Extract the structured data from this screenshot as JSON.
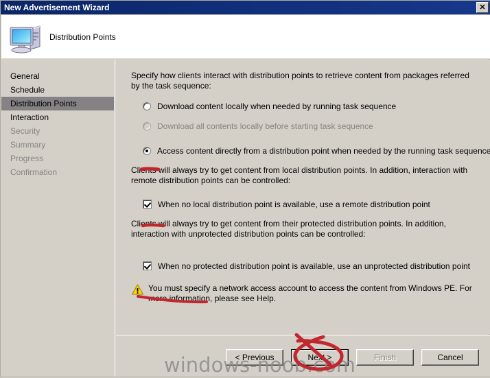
{
  "window": {
    "title": "New Advertisement Wizard",
    "close_label": "✕"
  },
  "header": {
    "title": "Distribution Points",
    "icon": "computer-icon"
  },
  "sidebar": {
    "items": [
      {
        "label": "General",
        "state": "normal"
      },
      {
        "label": "Schedule",
        "state": "normal"
      },
      {
        "label": "Distribution Points",
        "state": "selected"
      },
      {
        "label": "Interaction",
        "state": "normal"
      },
      {
        "label": "Security",
        "state": "disabled"
      },
      {
        "label": "Summary",
        "state": "disabled"
      },
      {
        "label": "Progress",
        "state": "disabled"
      },
      {
        "label": "Confirmation",
        "state": "disabled"
      }
    ]
  },
  "content": {
    "intro": "Specify how clients interact with distribution points to retrieve content from packages referred by the task sequence:",
    "radio_options": [
      {
        "label": "Download content locally when needed by running task sequence",
        "accel": "D",
        "checked": false,
        "disabled": false
      },
      {
        "label": "Download all contents locally before starting task sequence",
        "accel": "o",
        "checked": false,
        "disabled": true
      },
      {
        "label": "Access content directly from a distribution point when needed by the running task sequence",
        "accel": "c",
        "checked": true,
        "disabled": false
      }
    ],
    "local_note": "Clients will always try to get content from local distribution points. In addition, interaction with remote distribution points can be controlled:",
    "checkbox_remote": {
      "label": "When no local distribution point is available, use a remote distribution point",
      "accel": "h",
      "checked": true
    },
    "protected_note": "Clients will always try to get content from their protected distribution points. In addition, interaction with unprotected distribution points can be controlled:",
    "checkbox_unprotected": {
      "label": "When no protected distribution point is available, use an unprotected distribution point",
      "accel": "e",
      "checked": true
    },
    "warning": {
      "icon": "warning-triangle-icon",
      "text": "You must specify a network access account to access the content from Windows PE.  For more information, please see Help."
    }
  },
  "buttons": {
    "previous": {
      "label": "< Previous",
      "disabled": false,
      "default": false
    },
    "next": {
      "label": "Next >",
      "disabled": false,
      "default": true
    },
    "finish": {
      "label": "Finish",
      "disabled": true,
      "default": false
    },
    "cancel": {
      "label": "Cancel",
      "disabled": false,
      "default": false
    }
  },
  "watermark": {
    "text": "windows-noob.com"
  },
  "annotations": {
    "ink_color": "#c1272d",
    "marks": [
      "underline-under-access-radio",
      "underline-under-remote-checkbox",
      "stroke-over-warning-text",
      "circle-around-next-button"
    ]
  },
  "colors": {
    "titlebar": "#0b2667",
    "face": "#d4d0c8",
    "selected_nav": "#848284",
    "disabled_text": "#868482",
    "ink": "#c1272d"
  }
}
